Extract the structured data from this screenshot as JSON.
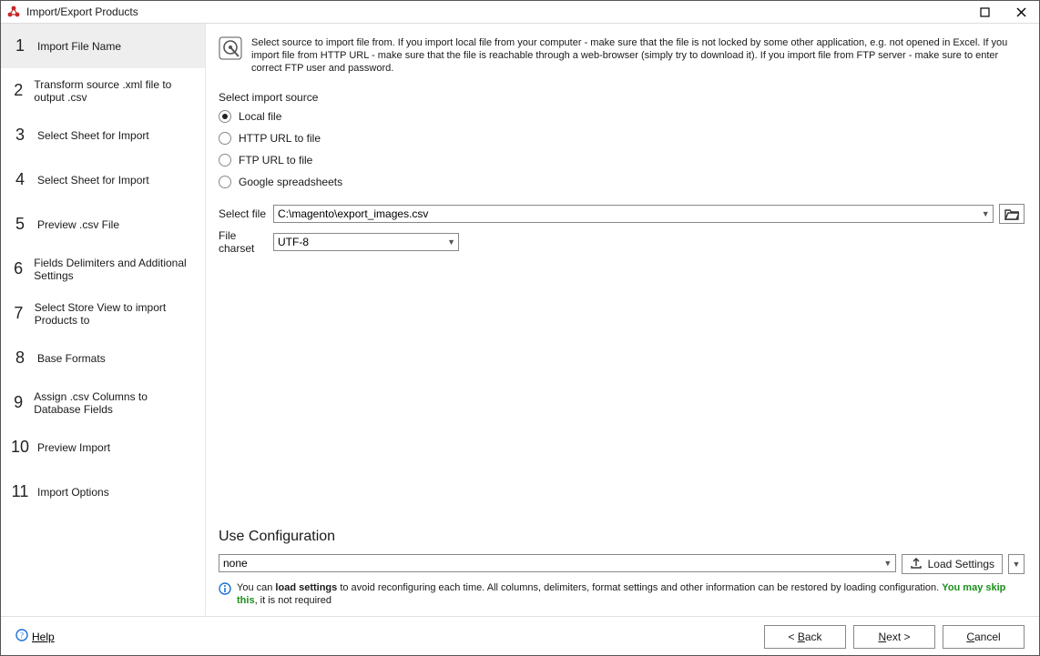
{
  "window": {
    "title": "Import/Export Products"
  },
  "sidebar": {
    "active_index": 0,
    "steps": [
      {
        "num": "1",
        "label": "Import File Name"
      },
      {
        "num": "2",
        "label": "Transform source .xml file to output .csv"
      },
      {
        "num": "3",
        "label": "Select Sheet for Import"
      },
      {
        "num": "4",
        "label": "Select Sheet for Import"
      },
      {
        "num": "5",
        "label": "Preview .csv File"
      },
      {
        "num": "6",
        "label": "Fields Delimiters and Additional Settings"
      },
      {
        "num": "7",
        "label": "Select Store View to import Products to"
      },
      {
        "num": "8",
        "label": "Base Formats"
      },
      {
        "num": "9",
        "label": "Assign .csv Columns to Database Fields"
      },
      {
        "num": "10",
        "label": "Preview Import"
      },
      {
        "num": "11",
        "label": "Import Options"
      }
    ]
  },
  "info_text": "Select source to import file from. If you import local file from your computer - make sure that the file is not locked by some other application, e.g. not opened in Excel. If you import file from HTTP URL - make sure that the file is reachable through a web-browser (simply try to download it). If you import file from FTP server - make sure to enter correct FTP user and password.",
  "source": {
    "label": "Select import source",
    "selected": 0,
    "options": [
      "Local file",
      "HTTP URL to file",
      "FTP URL to file",
      "Google spreadsheets"
    ]
  },
  "file": {
    "label": "Select file",
    "value": "C:\\magento\\export_images.csv"
  },
  "charset": {
    "label": "File charset",
    "value": "UTF-8"
  },
  "config": {
    "title": "Use Configuration",
    "value": "none",
    "load_label": "Load Settings",
    "hint_pre": "You can ",
    "hint_bold": "load settings",
    "hint_mid": " to avoid reconfiguring each time. All columns, delimiters, format settings and other information can be restored by loading configuration. ",
    "hint_green": "You may skip this",
    "hint_post": ", it is not required"
  },
  "bottom": {
    "help": "Help",
    "back": "< Back",
    "next": "Next >",
    "cancel": "Cancel"
  }
}
